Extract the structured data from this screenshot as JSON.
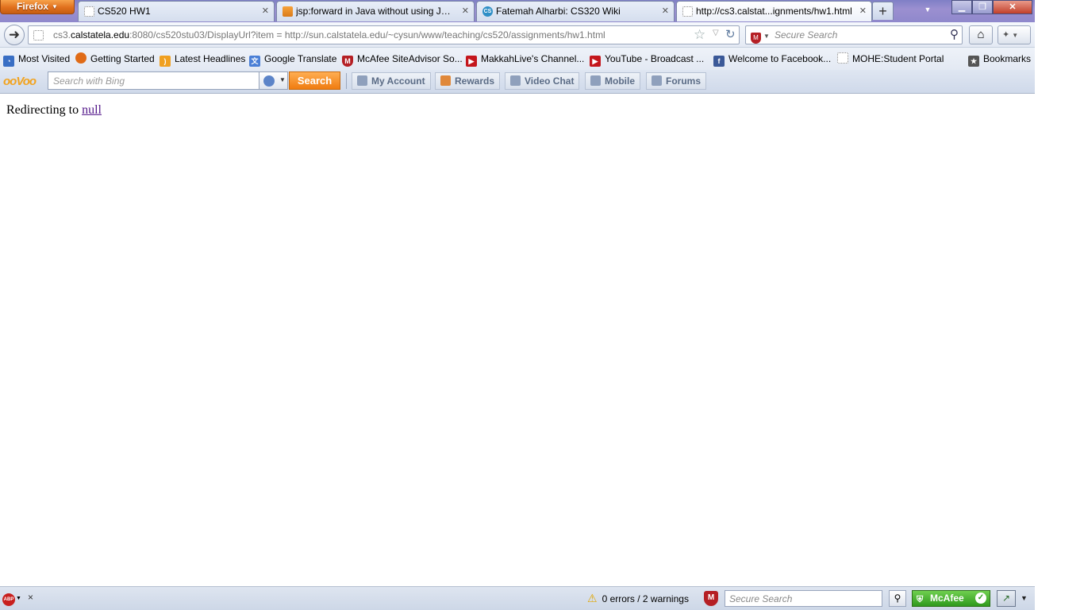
{
  "browser": {
    "menu_button": "Firefox",
    "tabs": [
      {
        "title": "CS520 HW1",
        "icon": "blank-page-icon"
      },
      {
        "title": "jsp:forward in Java without using JSP ...",
        "icon": "stackoverflow-icon"
      },
      {
        "title": "Fatemah Alharbi: CS320 Wiki",
        "icon": "cs-wiki-icon"
      },
      {
        "title": "http://cs3.calstat...ignments/hw1.html",
        "icon": "blank-page-icon",
        "active": true
      }
    ],
    "new_tab_label": "+",
    "url": {
      "host_prefix": "cs3.",
      "host_domain": "calstatela.edu",
      "rest": ":8080/cs520stu03/DisplayUrl?item = http://sun.calstatela.edu/~cysun/www/teaching/cs520/assignments/hw1.html"
    },
    "search_placeholder": "Secure Search"
  },
  "bookmarks": [
    {
      "label": "Most Visited",
      "icon": "most-visited-icon",
      "color": "#3a6fc4"
    },
    {
      "label": "Getting Started",
      "icon": "firefox-icon",
      "color": "#e06b17"
    },
    {
      "label": "Latest Headlines",
      "icon": "rss-icon",
      "color": "#f0a020"
    },
    {
      "label": "Google Translate",
      "icon": "translate-icon",
      "color": "#4a7fd6"
    },
    {
      "label": "McAfee SiteAdvisor So...",
      "icon": "mcafee-icon",
      "color": "#b51f24"
    },
    {
      "label": "MakkahLive's Channel...",
      "icon": "youtube-icon",
      "color": "#c4161c"
    },
    {
      "label": "YouTube - Broadcast ...",
      "icon": "youtube-icon",
      "color": "#c4161c"
    },
    {
      "label": "Welcome to Facebook...",
      "icon": "facebook-icon",
      "color": "#3b5998"
    },
    {
      "label": "MOHE:Student Portal",
      "icon": "blank-page-icon",
      "color": "#ffffff"
    },
    {
      "label": "Bookmarks",
      "icon": "bookmarks-icon",
      "color": "#555555"
    }
  ],
  "toolbar": {
    "logo": "ooVoo",
    "bing_placeholder": "Search with Bing",
    "search_button": "Search",
    "buttons": [
      "My Account",
      "Rewards",
      "Video Chat",
      "Mobile",
      "Forums"
    ]
  },
  "page": {
    "text": "Redirecting to ",
    "link": "null"
  },
  "status": {
    "abp_label": "ABP",
    "close_label": "×",
    "errors": "0 errors / 2 warnings",
    "search_placeholder": "Secure Search",
    "mcafee_label": "McAfee"
  }
}
